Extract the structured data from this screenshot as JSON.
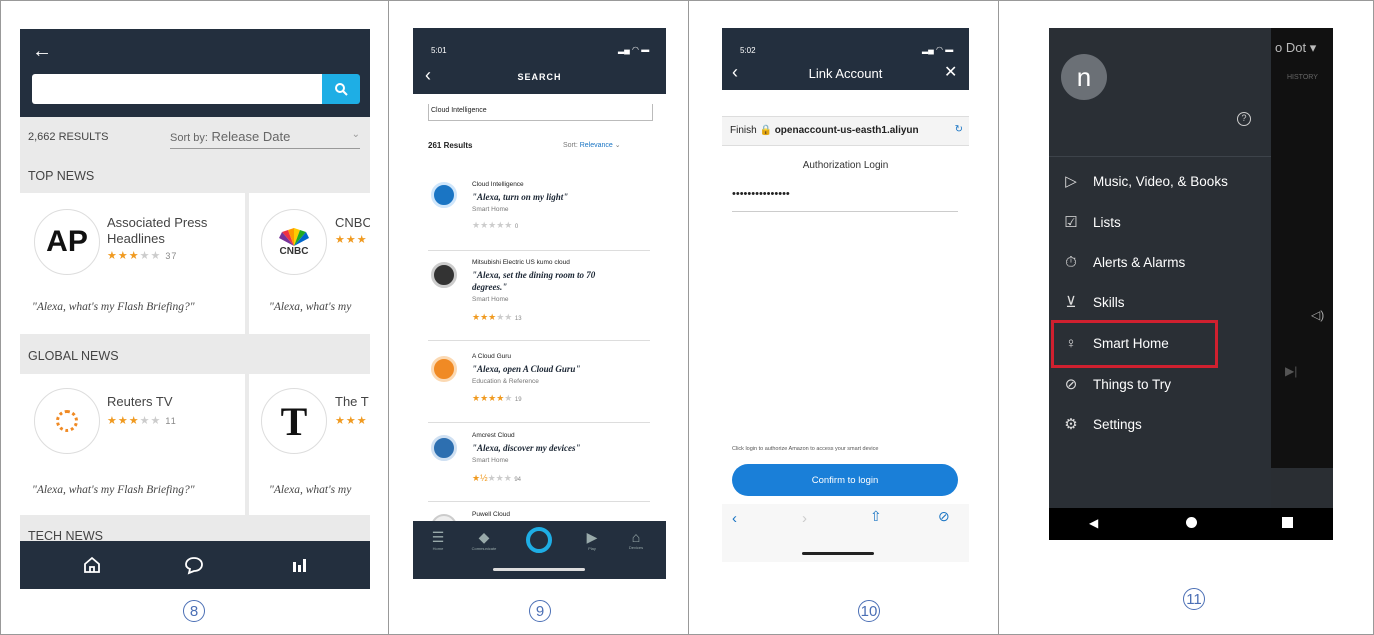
{
  "panel8": {
    "back_icon": "arrow-left-icon",
    "search_placeholder": "",
    "results_count": "2,662 RESULTS",
    "sort_label": "Sort by:",
    "sort_value": "Release Date",
    "sections": [
      {
        "title": "TOP NEWS"
      },
      {
        "title": "GLOBAL NEWS"
      },
      {
        "title": "TECH NEWS"
      }
    ],
    "top_news": [
      {
        "logo": "AP",
        "name": "Associated Press Headlines",
        "rating_count": "37",
        "quote": "\"Alexa, what's my Flash Briefing?\""
      },
      {
        "logo": "CNBC",
        "name": "CNBC",
        "rating_count": "",
        "quote": "\"Alexa, what's my"
      }
    ],
    "global_news": [
      {
        "logo": "reuters",
        "name": "Reuters TV",
        "rating_count": "11",
        "quote": "\"Alexa, what's my Flash Briefing?\""
      },
      {
        "logo": "T",
        "name": "The T",
        "rating_count": "",
        "quote": "\"Alexa, what's my"
      }
    ],
    "caption": "8"
  },
  "panel9": {
    "time": "5:01",
    "title": "SEARCH",
    "search_value": "Cloud Intelligence",
    "results": "261 Results",
    "sort_label": "Sort:",
    "sort_value": "Relevance",
    "items": [
      {
        "name": "Cloud Intelligence",
        "quote": "\"Alexa, turn on my light\"",
        "quote2": "",
        "category": "Smart Home",
        "count": "0",
        "rating": 0,
        "color": "#1a75c4"
      },
      {
        "name": "Mitsubishi Electric US kumo cloud",
        "quote": "\"Alexa, set the dining room to 70",
        "quote2": "degrees.\"",
        "category": "Smart Home",
        "count": "13",
        "rating": 3,
        "color": "#333"
      },
      {
        "name": "A Cloud Guru",
        "quote": "\"Alexa, open A Cloud Guru\"",
        "quote2": "",
        "category": "Education & Reference",
        "count": "19",
        "rating": 4,
        "color": "#f08a24"
      },
      {
        "name": "Amcrest Cloud",
        "quote": "\"Alexa, discover my devices\"",
        "quote2": "",
        "category": "Smart Home",
        "count": "94",
        "rating": 1.5,
        "color": "#2d6fb0"
      },
      {
        "name": "Puwell Cloud",
        "quote": "",
        "quote2": "",
        "category": "",
        "count": "",
        "rating": 0,
        "color": "#bbb"
      }
    ],
    "tabs": [
      "Home",
      "Communicate",
      "",
      "Play",
      "Devices"
    ],
    "caption": "9"
  },
  "panel10": {
    "time": "5:02",
    "title": "Link Account",
    "finish": "Finish",
    "url": "openaccount-us-easth1.aliyun",
    "auth_title": "Authorization Login",
    "password": "•••••••••••••••",
    "note": "Click login to authorize Amazon to access your smart device",
    "confirm": "Confirm to login",
    "caption": "10"
  },
  "panel11": {
    "avatar": "n",
    "behind_title": "o Dot",
    "behind_tab": "HISTORY",
    "menu": [
      {
        "icon": "play-icon",
        "glyph": "▷",
        "label": "Music, Video, & Books"
      },
      {
        "icon": "checkbox-icon",
        "glyph": "☑",
        "label": "Lists"
      },
      {
        "icon": "alarm-icon",
        "glyph": "⏱",
        "label": "Alerts & Alarms"
      },
      {
        "icon": "cart-icon",
        "glyph": "⊻",
        "label": "Skills"
      },
      {
        "icon": "bulb-icon",
        "glyph": "♀",
        "label": "Smart Home"
      },
      {
        "icon": "compass-icon",
        "glyph": "⊘",
        "label": "Things to Try"
      },
      {
        "icon": "gear-icon",
        "glyph": "⚙",
        "label": "Settings"
      }
    ],
    "highlight_color": "#d0202f",
    "caption": "11"
  }
}
